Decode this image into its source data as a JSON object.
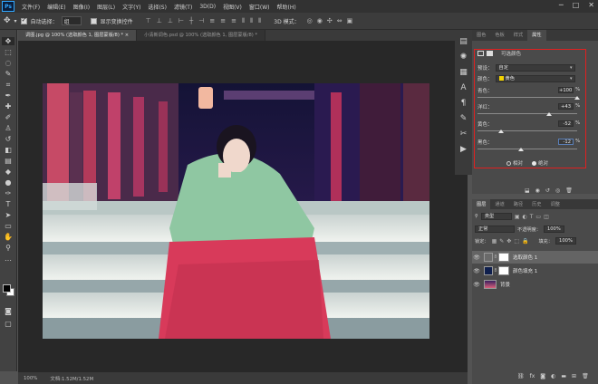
{
  "menubar": {
    "logo": "Ps",
    "items": [
      "文件(F)",
      "编辑(E)",
      "图像(I)",
      "图层(L)",
      "文字(Y)",
      "选择(S)",
      "滤镜(T)",
      "3D(D)",
      "视图(V)",
      "窗口(W)",
      "帮助(H)"
    ],
    "window_controls": [
      "─",
      "□",
      "✕"
    ]
  },
  "options": {
    "auto_select_label": "自动选择：",
    "auto_select_value": "组",
    "show_transform_label": "显示变换控件",
    "mode_3d_label": "3D 模式："
  },
  "tabs": [
    {
      "label": "调图.jpg @ 100% (选取颜色 1, 图层蒙版/8) * ×",
      "active": true
    },
    {
      "label": "小清新调色.psd @ 100% (选取颜色 1, 图层蒙版/8) *",
      "active": false
    }
  ],
  "status": {
    "zoom": "100%",
    "doc": "文档:1.52M/1.52M"
  },
  "properties": {
    "tabs": [
      "图色",
      "色板",
      "样式",
      "属性"
    ],
    "active_tab": "属性",
    "title": "可选颜色",
    "preset_label": "预设：",
    "preset_value": "自定",
    "colors_label": "颜色：",
    "colors_value": "黄色",
    "sliders": [
      {
        "label": "青色：",
        "value": "+100",
        "fraction": 1.0
      },
      {
        "label": "洋红：",
        "value": "+43",
        "fraction": 0.715
      },
      {
        "label": "黄色：",
        "value": "-52",
        "fraction": 0.24
      },
      {
        "label": "黑色：",
        "value": "-12",
        "fraction": 0.44
      }
    ],
    "method_relative": "相对",
    "method_absolute": "绝对",
    "selected_method": "absolute"
  },
  "layers": {
    "tabs": [
      "图层",
      "通道",
      "路径",
      "历史",
      "调整"
    ],
    "active_tab": "图层",
    "kind_label": "类型",
    "blend_mode": "正常",
    "opacity_label": "不透明度：",
    "opacity_value": "100%",
    "lock_label": "锁定：",
    "fill_label": "填充：",
    "fill_value": "100%",
    "items": [
      {
        "name": "选取颜色 1",
        "selected": true,
        "thumb_color": "#ffffff"
      },
      {
        "name": "颜色填充 1",
        "selected": false,
        "thumb_color": "#0f1f4d"
      },
      {
        "name": "背景",
        "selected": false,
        "thumb_color": "#8a4a5a"
      }
    ]
  },
  "colors": {
    "accent_box": "#e02020",
    "yellow_swatch": "#f4d400"
  }
}
